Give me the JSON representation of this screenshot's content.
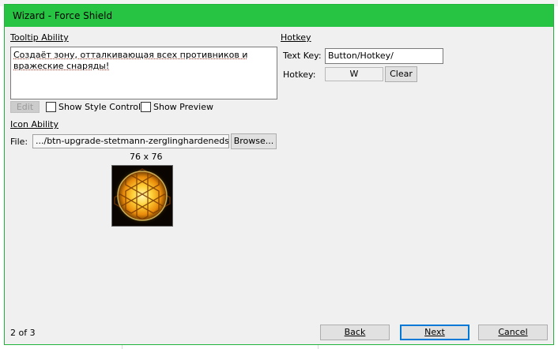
{
  "window": {
    "title": "Wizard - Force Shield",
    "accent_color": "#27c443"
  },
  "tooltip": {
    "section_label": "Tooltip Ability",
    "text": "Создаёт зону, отталкивающая всех противников и вражеские снаряды!",
    "edit_label": "Edit",
    "show_style_controls_label": "Show Style Controls",
    "show_style_controls_checked": false,
    "show_preview_label": "Show Preview",
    "show_preview_checked": false
  },
  "hotkey": {
    "section_label": "Hotkey",
    "text_key_label": "Text Key:",
    "text_key_value": "Button/Hotkey/",
    "hotkey_label": "Hotkey:",
    "hotkey_value": "W",
    "clear_label": "Clear"
  },
  "icon": {
    "section_label": "Icon Ability",
    "file_label": "File:",
    "file_value": ".../btn-upgrade-stetmann-zerglinghardenedshield.dds",
    "browse_label": "Browse...",
    "size_label": "76 x 76",
    "icon_name": "hexagon-shield-icon"
  },
  "footer": {
    "page_indicator": "2 of 3",
    "back_label": "Back",
    "next_label": "Next",
    "cancel_label": "Cancel"
  }
}
